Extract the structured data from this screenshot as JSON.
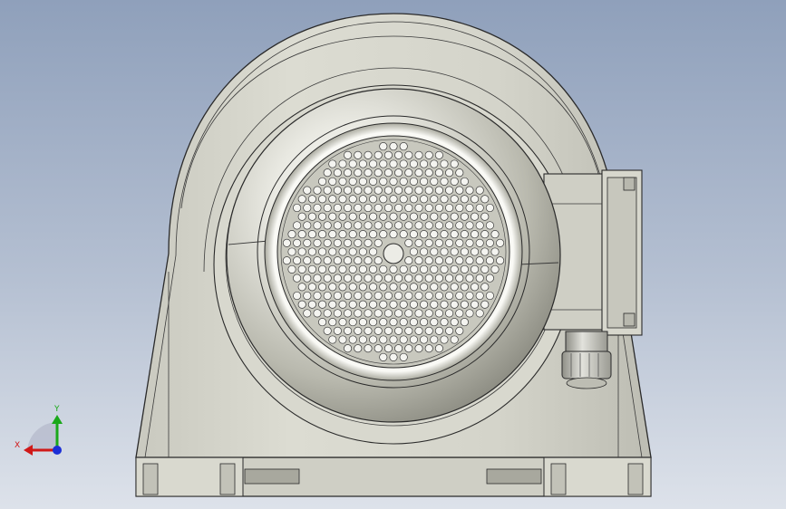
{
  "viewport": {
    "background_top": "#8fa0bb",
    "background_bottom": "#dde2ea"
  },
  "model": {
    "body_color": "#d6d6cc",
    "shade_color": "#b9b9ae",
    "edge_color": "#2a2a2a",
    "hole_color": "#f4f4f0"
  },
  "triad": {
    "x_label": "X",
    "y_label": "Y",
    "x_color": "#d01818",
    "y_color": "#1aa81a",
    "z_color": "#1b2fd6"
  }
}
